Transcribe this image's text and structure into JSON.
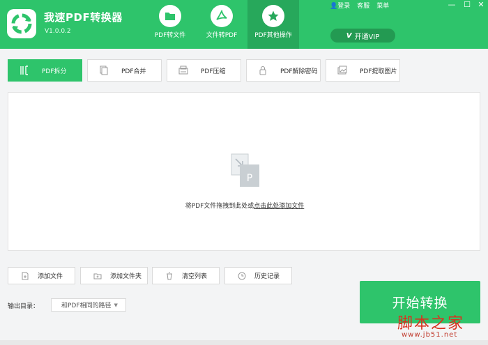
{
  "app": {
    "title": "我速PDF转换器",
    "version": "V1.0.0.2"
  },
  "nav": [
    {
      "label": "PDF转文件",
      "icon": "folder-icon"
    },
    {
      "label": "文件转PDF",
      "icon": "pdf-icon"
    },
    {
      "label": "PDF其他操作",
      "icon": "star-icon",
      "active": true
    }
  ],
  "top_links": {
    "login": "登录",
    "service": "客服",
    "menu": "菜单"
  },
  "window": {
    "minimize": "—",
    "maximize": "☐",
    "close": "✕"
  },
  "vip": {
    "mark": "V",
    "label": "开通VIP"
  },
  "tabs": [
    {
      "label": "PDF拆分",
      "icon": "split-icon",
      "active": true
    },
    {
      "label": "PDF合并",
      "icon": "merge-icon"
    },
    {
      "label": "PDF压缩",
      "icon": "compress-icon"
    },
    {
      "label": "PDF解除密码",
      "icon": "unlock-icon"
    },
    {
      "label": "PDF提取图片",
      "icon": "image-icon"
    }
  ],
  "drop": {
    "text_prefix": "将PDF文件拖拽到此处或",
    "text_link": "点击此处添加文件",
    "icon_letter": "P"
  },
  "actions": [
    {
      "label": "添加文件",
      "icon": "add-file-icon"
    },
    {
      "label": "添加文件夹",
      "icon": "add-folder-icon"
    },
    {
      "label": "清空列表",
      "icon": "trash-icon"
    },
    {
      "label": "历史记录",
      "icon": "clock-icon"
    }
  ],
  "output": {
    "label": "输出目录：",
    "value": "和PDF相同的路径"
  },
  "start": {
    "label": "开始转换"
  },
  "watermark": {
    "main": "脚本之家",
    "sub": "www.jb51.net"
  },
  "colors": {
    "brand": "#2ec46b",
    "brand_dark": "#27a85b",
    "watermark": "#d9321f"
  }
}
